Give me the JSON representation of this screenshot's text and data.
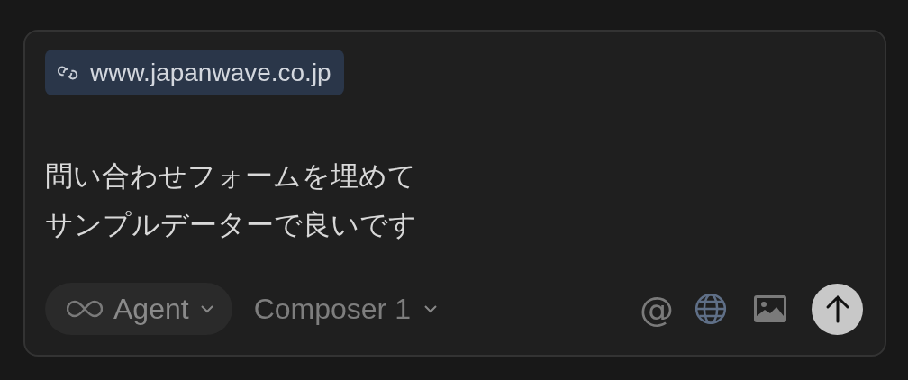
{
  "context_chip": {
    "label": "www.japanwave.co.jp"
  },
  "message": [
    "問い合わせフォームを埋めて",
    "サンプルデーターで良いです"
  ],
  "mode_selector": {
    "label": "Agent"
  },
  "model_selector": {
    "label": "Composer 1"
  },
  "mention_button": "@",
  "web_search": {
    "on": true
  }
}
